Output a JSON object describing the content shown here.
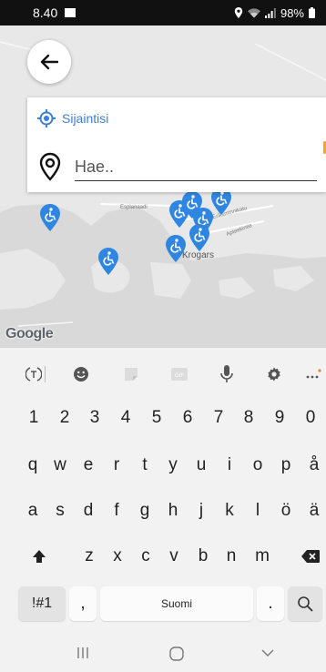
{
  "status_bar": {
    "time": "8.40",
    "battery": "98%"
  },
  "location": {
    "label": "Sijaintisi"
  },
  "search": {
    "placeholder": "Hae.."
  },
  "map": {
    "labels": [
      "Esplanaadi",
      "Eriksminnikatu",
      "Apteekintie",
      "Krogars"
    ],
    "attribution": "Google"
  },
  "keyboard": {
    "toolbar": [
      "text-mode-icon",
      "emoji-icon",
      "sticker-icon",
      "gif-icon",
      "mic-icon",
      "settings-icon",
      "more-icon"
    ],
    "gif_label": "GIF",
    "rows": {
      "numbers": [
        "1",
        "2",
        "3",
        "4",
        "5",
        "6",
        "7",
        "8",
        "9",
        "0"
      ],
      "row1": [
        "q",
        "w",
        "e",
        "r",
        "t",
        "y",
        "u",
        "i",
        "o",
        "p",
        "å"
      ],
      "row2": [
        "a",
        "s",
        "d",
        "f",
        "g",
        "h",
        "j",
        "k",
        "l",
        "ö",
        "ä"
      ],
      "row3": [
        "z",
        "x",
        "c",
        "v",
        "b",
        "n",
        "m"
      ]
    },
    "symbols_key": "!#1",
    "comma_key": ",",
    "space_label": "Suomi",
    "period_key": "."
  },
  "colors": {
    "accent": "#3d7fd6",
    "pin": "#2f86e0",
    "status_bar": "#111111"
  }
}
